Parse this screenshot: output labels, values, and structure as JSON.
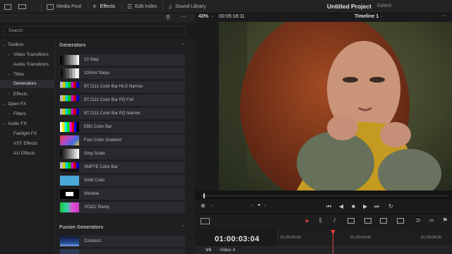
{
  "toolbar": {
    "media_pool": "Media Pool",
    "effects": "Effects",
    "edit_index": "Edit Index",
    "sound_library": "Sound Library",
    "project_title": "Untitled Project",
    "project_status": "Edited"
  },
  "search": {
    "label": "Search"
  },
  "tree": {
    "toolbox": "Toolbox",
    "video_transitions": "Video Transitions",
    "audio_transitions": "Audio Transitions",
    "titles": "Titles",
    "generators": "Generators",
    "effects": "Effects",
    "open_fx": "Open FX",
    "filters": "Filters",
    "audio_fx": "Audio FX",
    "fairlight_fx": "Fairlight FX",
    "vst_effects": "VST Effects",
    "au_effects": "AU Effects"
  },
  "generators": {
    "header": "Generators",
    "items": [
      "10 Step",
      "100mV Steps",
      "BT.2111 Color Bar HLG Narrow",
      "BT.2111 Color Bar PQ Full",
      "BT.2111 Color Bar PQ Narrow",
      "EBU Color Bar",
      "Four Color Gradient",
      "Grey Scale",
      "SMPTE Color Bar",
      "Solid Color",
      "Window",
      "YCbCr Ramp"
    ]
  },
  "fusion_generators": {
    "header": "Fusion Generators",
    "items": [
      "Contours"
    ]
  },
  "viewer": {
    "zoom": "43%",
    "timecode": "00:05:18:11",
    "timeline_name": "Timeline 1"
  },
  "timeline": {
    "current_timecode": "01:00:03:04",
    "ruler_marks": [
      "01:00:00:00",
      "01:00:04:00",
      "01:00:08:00"
    ],
    "track_id": "V4",
    "track_name": "Video 4"
  },
  "colors": {
    "accent": "#e04040",
    "panel": "#1f1f22",
    "solid_color": "#4aa8d8"
  }
}
